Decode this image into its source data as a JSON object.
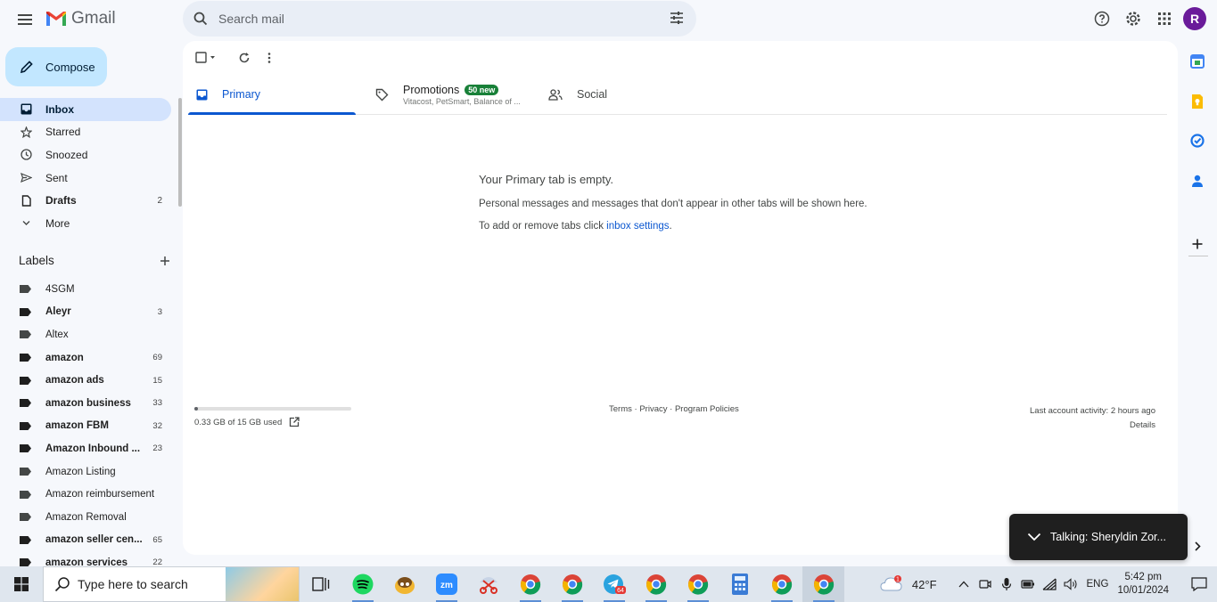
{
  "header": {
    "app_name": "Gmail",
    "search_placeholder": "Search mail",
    "avatar_initial": "R"
  },
  "compose_label": "Compose",
  "nav": [
    {
      "label": "Inbox",
      "count": "",
      "active": true
    },
    {
      "label": "Starred",
      "count": ""
    },
    {
      "label": "Snoozed",
      "count": ""
    },
    {
      "label": "Sent",
      "count": ""
    },
    {
      "label": "Drafts",
      "count": "2"
    },
    {
      "label": "More",
      "count": ""
    }
  ],
  "labels_title": "Labels",
  "labels": [
    {
      "name": "4SGM",
      "count": ""
    },
    {
      "name": "Aleyr",
      "count": "3"
    },
    {
      "name": "Altex",
      "count": ""
    },
    {
      "name": "amazon",
      "count": "69"
    },
    {
      "name": "amazon ads",
      "count": "15"
    },
    {
      "name": "amazon business",
      "count": "33"
    },
    {
      "name": "amazon FBM",
      "count": "32"
    },
    {
      "name": "Amazon Inbound ...",
      "count": "23"
    },
    {
      "name": "Amazon Listing",
      "count": ""
    },
    {
      "name": "Amazon reimbursement",
      "count": ""
    },
    {
      "name": "Amazon Removal",
      "count": ""
    },
    {
      "name": "amazon seller cen...",
      "count": "65"
    },
    {
      "name": "amazon services",
      "count": "22"
    }
  ],
  "tabs": {
    "primary": "Primary",
    "promotions": "Promotions",
    "promotions_badge": "50 new",
    "promotions_sub": "Vitacost, PetSmart, Balance of ...",
    "social": "Social"
  },
  "empty": {
    "title": "Your Primary tab is empty.",
    "line1": "Personal messages and messages that don't appear in other tabs will be shown here.",
    "line2_prefix": "To add or remove tabs click ",
    "line2_link": "inbox settings",
    "line2_suffix": "."
  },
  "storage": {
    "text": "0.33 GB of 15 GB used",
    "fraction": 0.022
  },
  "footer": {
    "terms": "Terms",
    "sep1": " · ",
    "privacy": "Privacy",
    "sep2": " · ",
    "policies": "Program Policies"
  },
  "activity": {
    "line": "Last account activity: 2 hours ago",
    "details": "Details"
  },
  "toast": {
    "text": "Talking: Sheryldin Zor..."
  },
  "taskbar": {
    "search_placeholder": "Type here to search",
    "telegram_badge": "64",
    "weather_temp": "42°F",
    "weather_badge": "1",
    "lang": "ENG",
    "time": "5:42 pm",
    "date": "10/01/2024"
  },
  "colors": {
    "compose_bg": "#c2e7ff",
    "active_nav_bg": "#d3e3fd",
    "primary_blue": "#0b57d0",
    "badge_green": "#188038",
    "avatar_purple": "#6a1b9a"
  }
}
